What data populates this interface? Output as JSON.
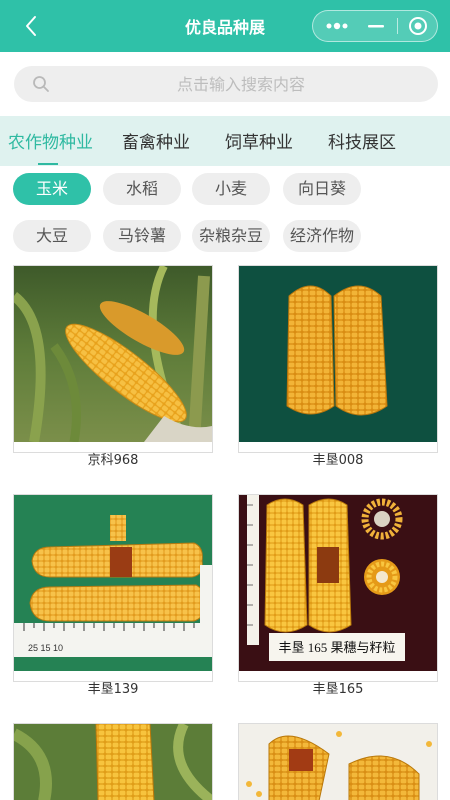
{
  "header": {
    "title": "优良品种展",
    "back_icon": "chevron-left-icon",
    "capsule_icons": [
      "more-dots-icon",
      "minimize-icon",
      "record-icon"
    ]
  },
  "search": {
    "placeholder": "点击输入搜索内容",
    "value": ""
  },
  "tabs": [
    {
      "label": "农作物种业",
      "active": true
    },
    {
      "label": "畜禽种业",
      "active": false
    },
    {
      "label": "饲草种业",
      "active": false
    },
    {
      "label": "科技展区",
      "active": false
    }
  ],
  "chips": [
    {
      "label": "玉米",
      "active": true
    },
    {
      "label": "水稻",
      "active": false
    },
    {
      "label": "小麦",
      "active": false
    },
    {
      "label": "向日葵",
      "active": false
    },
    {
      "label": "大豆",
      "active": false
    },
    {
      "label": "马铃薯",
      "active": false
    },
    {
      "label": "杂粮杂豆",
      "active": false
    },
    {
      "label": "经济作物",
      "active": false
    }
  ],
  "products": [
    {
      "name": "京科968"
    },
    {
      "name": "丰垦008"
    },
    {
      "name": "丰垦139",
      "ruler_text": "25 15 10"
    },
    {
      "name": "丰垦165",
      "photo_caption": "丰垦 165 果穗与籽粒"
    },
    {
      "name": ""
    },
    {
      "name": ""
    }
  ],
  "colors": {
    "accent": "#2fc1a8",
    "tab_bar_bg": "#dff2ef",
    "chip_bg": "#eeeeee"
  }
}
